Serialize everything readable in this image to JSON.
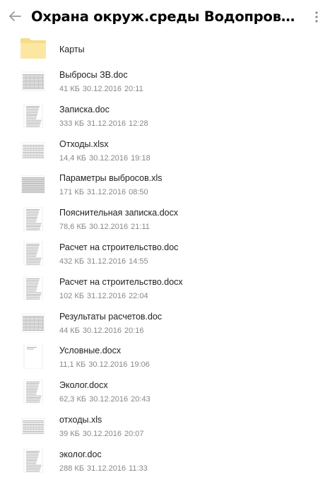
{
  "header": {
    "title": "Охрана окруж.среды Водопровод Дачное (Коровин Т.А.)"
  },
  "folder": {
    "name": "Карты"
  },
  "files": [
    {
      "name": "Выбросы ЗВ.doc",
      "size": "41 КБ",
      "date": "30.12.2016",
      "time": "20:11",
      "kind": "doc-table"
    },
    {
      "name": "Записка.doc",
      "size": "333 КБ",
      "date": "31.12.2016",
      "time": "12:28",
      "kind": "doc-text"
    },
    {
      "name": "Отходы.xlsx",
      "size": "14,4 КБ",
      "date": "30.12.2016",
      "time": "19:18",
      "kind": "sheet"
    },
    {
      "name": "Параметры выбросов.xls",
      "size": "171 КБ",
      "date": "31.12.2016",
      "time": "08:50",
      "kind": "sheet-dense"
    },
    {
      "name": "Пояснительная записка.docx",
      "size": "78,6 КБ",
      "date": "30.12.2016",
      "time": "21:11",
      "kind": "doc-text"
    },
    {
      "name": "Расчет на строительство.doc",
      "size": "432 КБ",
      "date": "31.12.2016",
      "time": "14:55",
      "kind": "doc-text"
    },
    {
      "name": "Расчет на строительство.docx",
      "size": "102 КБ",
      "date": "31.12.2016",
      "time": "22:04",
      "kind": "doc-text"
    },
    {
      "name": "Результаты расчетов.doc",
      "size": "44 КБ",
      "date": "30.12.2016",
      "time": "20:16",
      "kind": "doc-table"
    },
    {
      "name": "Условные.docx",
      "size": "11,1 КБ",
      "date": "30.12.2016",
      "time": "19:06",
      "kind": "doc-blank"
    },
    {
      "name": "Эколог.docx",
      "size": "62,3 КБ",
      "date": "30.12.2016",
      "time": "20:43",
      "kind": "doc-text"
    },
    {
      "name": "отходы.xls",
      "size": "39 КБ",
      "date": "30.12.2016",
      "time": "20:07",
      "kind": "sheet"
    },
    {
      "name": "эколог.doc",
      "size": "288 КБ",
      "date": "31.12.2016",
      "time": "11:33",
      "kind": "doc-text"
    }
  ],
  "colors": {
    "folder": "#fbe7a1",
    "folder_dark": "#f5d97a",
    "meta_text": "#888888",
    "icon": "#9a9a9a"
  },
  "icons": {
    "back": "arrow-left-icon",
    "more": "more-vertical-icon",
    "folder": "folder-icon"
  }
}
